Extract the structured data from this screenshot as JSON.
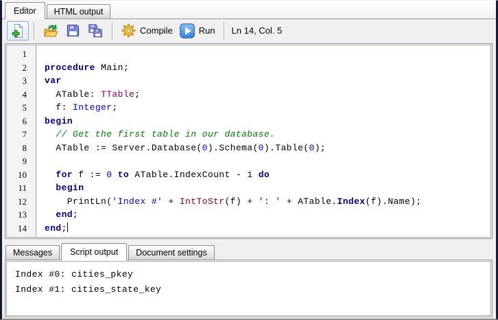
{
  "colors": {
    "window_border": "#161c2e",
    "keyword": "#000080",
    "type": "#800080",
    "number": "#0000cd",
    "string": "#0000cd",
    "comment": "#008000",
    "function": "#990000",
    "run_accent": "#3d7fd6",
    "gear_accent": "#f4c84e",
    "folder_accent": "#f3bf3e"
  },
  "top_tabs": [
    {
      "label": "Editor",
      "active": true
    },
    {
      "label": "HTML output",
      "active": false
    }
  ],
  "toolbar": {
    "icons": [
      "new-document",
      "open-file",
      "save",
      "save-all",
      "compile-gear",
      "run-play"
    ],
    "compile_label": "Compile",
    "run_label": "Run",
    "status": "Ln 14, Col. 5"
  },
  "editor": {
    "caret": {
      "line": 14,
      "col": 5
    },
    "lines": [
      {
        "n": "1",
        "tokens": []
      },
      {
        "n": "2",
        "tokens": [
          {
            "c": "kw",
            "t": "procedure"
          },
          {
            "c": "pl",
            "t": " Main;"
          }
        ]
      },
      {
        "n": "3",
        "tokens": [
          {
            "c": "kw",
            "t": "var"
          }
        ]
      },
      {
        "n": "4",
        "tokens": [
          {
            "c": "pl",
            "t": "  ATable: "
          },
          {
            "c": "ty",
            "t": "TTable"
          },
          {
            "c": "pl",
            "t": ";"
          }
        ]
      },
      {
        "n": "5",
        "tokens": [
          {
            "c": "pl",
            "t": "  f: "
          },
          {
            "c": "num",
            "t": "Integer"
          },
          {
            "c": "pl",
            "t": ";"
          }
        ]
      },
      {
        "n": "6",
        "tokens": [
          {
            "c": "kw",
            "t": "begin"
          }
        ]
      },
      {
        "n": "7",
        "tokens": [
          {
            "c": "cm",
            "t": "  // Get the first table in our database."
          }
        ]
      },
      {
        "n": "8",
        "tokens": [
          {
            "c": "pl",
            "t": "  ATable := Server.Database("
          },
          {
            "c": "num",
            "t": "0"
          },
          {
            "c": "pl",
            "t": ").Schema("
          },
          {
            "c": "num",
            "t": "0"
          },
          {
            "c": "pl",
            "t": ").Table("
          },
          {
            "c": "num",
            "t": "0"
          },
          {
            "c": "pl",
            "t": ");"
          }
        ]
      },
      {
        "n": "9",
        "tokens": []
      },
      {
        "n": "10",
        "tokens": [
          {
            "c": "pl",
            "t": "  "
          },
          {
            "c": "kw",
            "t": "for"
          },
          {
            "c": "pl",
            "t": " f := "
          },
          {
            "c": "num",
            "t": "0"
          },
          {
            "c": "pl",
            "t": " "
          },
          {
            "c": "kw",
            "t": "to"
          },
          {
            "c": "pl",
            "t": " ATable.IndexCount - "
          },
          {
            "c": "num",
            "t": "1"
          },
          {
            "c": "pl",
            "t": " "
          },
          {
            "c": "kw",
            "t": "do"
          }
        ]
      },
      {
        "n": "11",
        "tokens": [
          {
            "c": "pl",
            "t": "  "
          },
          {
            "c": "kw",
            "t": "begin"
          }
        ]
      },
      {
        "n": "12",
        "tokens": [
          {
            "c": "pl",
            "t": "    PrintLn("
          },
          {
            "c": "str",
            "t": "'Index #'"
          },
          {
            "c": "pl",
            "t": " + "
          },
          {
            "c": "fn",
            "t": "IntToStr"
          },
          {
            "c": "pl",
            "t": "(f) + "
          },
          {
            "c": "str",
            "t": "': '"
          },
          {
            "c": "pl",
            "t": " + ATable."
          },
          {
            "c": "kw",
            "t": "Index"
          },
          {
            "c": "pl",
            "t": "(f).Name);"
          }
        ]
      },
      {
        "n": "13",
        "tokens": [
          {
            "c": "pl",
            "t": "  "
          },
          {
            "c": "kw",
            "t": "end"
          },
          {
            "c": "pl",
            "t": ";"
          }
        ]
      },
      {
        "n": "14",
        "tokens": [
          {
            "c": "kw",
            "t": "end"
          },
          {
            "c": "pl",
            "t": ";"
          }
        ],
        "caret": true
      }
    ]
  },
  "bottom_tabs": [
    {
      "label": "Messages",
      "active": false
    },
    {
      "label": "Script output",
      "active": true
    },
    {
      "label": "Document settings",
      "active": false
    }
  ],
  "output": {
    "lines": [
      "Index #0: cities_pkey",
      "Index #1: cities_state_key"
    ]
  }
}
